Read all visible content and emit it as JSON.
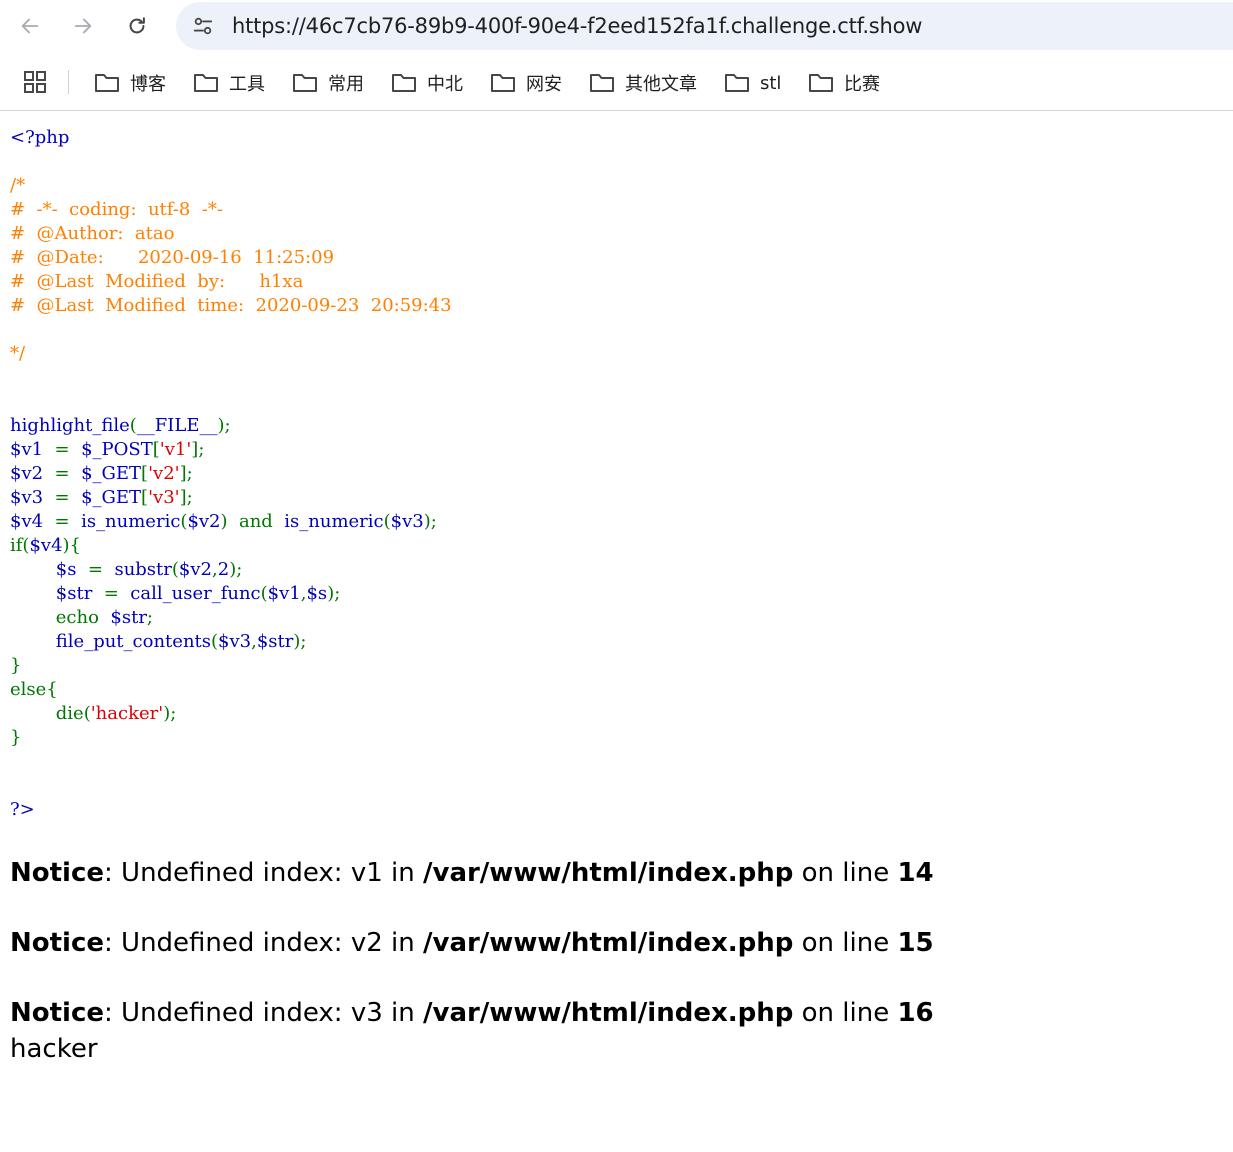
{
  "browser": {
    "url": "https://46c7cb76-89b9-400f-90e4-f2eed152fa1f.challenge.ctf.show",
    "bookmarks": [
      {
        "label": "博客"
      },
      {
        "label": "工具"
      },
      {
        "label": "常用"
      },
      {
        "label": "中北"
      },
      {
        "label": "网安"
      },
      {
        "label": "其他文章"
      },
      {
        "label": "stl"
      },
      {
        "label": "比赛"
      }
    ]
  },
  "source_code": {
    "lines": [
      [
        {
          "t": "<?php",
          "c": "def"
        }
      ],
      [],
      [
        {
          "t": "/*",
          "c": "com"
        }
      ],
      [
        {
          "t": "#  -*-  coding:  utf-8  -*-",
          "c": "com"
        }
      ],
      [
        {
          "t": "#  @Author:  atao",
          "c": "com"
        }
      ],
      [
        {
          "t": "#  @Date:      2020-09-16  11:25:09",
          "c": "com"
        }
      ],
      [
        {
          "t": "#  @Last  Modified  by:      h1xa",
          "c": "com"
        }
      ],
      [
        {
          "t": "#  @Last  Modified  time:  2020-09-23  20:59:43",
          "c": "com"
        }
      ],
      [],
      [
        {
          "t": "*/",
          "c": "com"
        }
      ],
      [],
      [],
      [
        {
          "t": "highlight_file",
          "c": "def"
        },
        {
          "t": "(",
          "c": "kw"
        },
        {
          "t": "__FILE__",
          "c": "def"
        },
        {
          "t": ");",
          "c": "kw"
        }
      ],
      [
        {
          "t": "$v1  ",
          "c": "def"
        },
        {
          "t": "=  ",
          "c": "kw"
        },
        {
          "t": "$_POST",
          "c": "def"
        },
        {
          "t": "[",
          "c": "kw"
        },
        {
          "t": "'v1'",
          "c": "str"
        },
        {
          "t": "];",
          "c": "kw"
        }
      ],
      [
        {
          "t": "$v2  ",
          "c": "def"
        },
        {
          "t": "=  ",
          "c": "kw"
        },
        {
          "t": "$_GET",
          "c": "def"
        },
        {
          "t": "[",
          "c": "kw"
        },
        {
          "t": "'v2'",
          "c": "str"
        },
        {
          "t": "];",
          "c": "kw"
        }
      ],
      [
        {
          "t": "$v3  ",
          "c": "def"
        },
        {
          "t": "=  ",
          "c": "kw"
        },
        {
          "t": "$_GET",
          "c": "def"
        },
        {
          "t": "[",
          "c": "kw"
        },
        {
          "t": "'v3'",
          "c": "str"
        },
        {
          "t": "];",
          "c": "kw"
        }
      ],
      [
        {
          "t": "$v4  ",
          "c": "def"
        },
        {
          "t": "=  ",
          "c": "kw"
        },
        {
          "t": "is_numeric",
          "c": "def"
        },
        {
          "t": "(",
          "c": "kw"
        },
        {
          "t": "$v2",
          "c": "def"
        },
        {
          "t": ")  and  ",
          "c": "kw"
        },
        {
          "t": "is_numeric",
          "c": "def"
        },
        {
          "t": "(",
          "c": "kw"
        },
        {
          "t": "$v3",
          "c": "def"
        },
        {
          "t": ");",
          "c": "kw"
        }
      ],
      [
        {
          "t": "if(",
          "c": "kw"
        },
        {
          "t": "$v4",
          "c": "def"
        },
        {
          "t": "){",
          "c": "kw"
        }
      ],
      [
        {
          "t": "        ",
          "c": "kw"
        },
        {
          "t": "$s  ",
          "c": "def"
        },
        {
          "t": "=  ",
          "c": "kw"
        },
        {
          "t": "substr",
          "c": "def"
        },
        {
          "t": "(",
          "c": "kw"
        },
        {
          "t": "$v2",
          "c": "def"
        },
        {
          "t": ",",
          "c": "kw"
        },
        {
          "t": "2",
          "c": "def"
        },
        {
          "t": ");",
          "c": "kw"
        }
      ],
      [
        {
          "t": "        ",
          "c": "kw"
        },
        {
          "t": "$str  ",
          "c": "def"
        },
        {
          "t": "=  ",
          "c": "kw"
        },
        {
          "t": "call_user_func",
          "c": "def"
        },
        {
          "t": "(",
          "c": "kw"
        },
        {
          "t": "$v1",
          "c": "def"
        },
        {
          "t": ",",
          "c": "kw"
        },
        {
          "t": "$s",
          "c": "def"
        },
        {
          "t": ");",
          "c": "kw"
        }
      ],
      [
        {
          "t": "        echo  ",
          "c": "kw"
        },
        {
          "t": "$str",
          "c": "def"
        },
        {
          "t": ";",
          "c": "kw"
        }
      ],
      [
        {
          "t": "        ",
          "c": "kw"
        },
        {
          "t": "file_put_contents",
          "c": "def"
        },
        {
          "t": "(",
          "c": "kw"
        },
        {
          "t": "$v3",
          "c": "def"
        },
        {
          "t": ",",
          "c": "kw"
        },
        {
          "t": "$str",
          "c": "def"
        },
        {
          "t": ");",
          "c": "kw"
        }
      ],
      [
        {
          "t": "}",
          "c": "kw"
        }
      ],
      [
        {
          "t": "else{",
          "c": "kw"
        }
      ],
      [
        {
          "t": "        die(",
          "c": "kw"
        },
        {
          "t": "'hacker'",
          "c": "str"
        },
        {
          "t": ");",
          "c": "kw"
        }
      ],
      [
        {
          "t": "}",
          "c": "kw"
        }
      ],
      [],
      [],
      [
        {
          "t": "?>",
          "c": "def"
        }
      ]
    ]
  },
  "notices": [
    {
      "label": "Notice",
      "message": ": Undefined index: v1 in ",
      "file": "/var/www/html/index.php",
      "on_line": " on line ",
      "line": "14"
    },
    {
      "label": "Notice",
      "message": ": Undefined index: v2 in ",
      "file": "/var/www/html/index.php",
      "on_line": " on line ",
      "line": "15"
    },
    {
      "label": "Notice",
      "message": ": Undefined index: v3 in ",
      "file": "/var/www/html/index.php",
      "on_line": " on line ",
      "line": "16"
    }
  ],
  "output": "hacker"
}
